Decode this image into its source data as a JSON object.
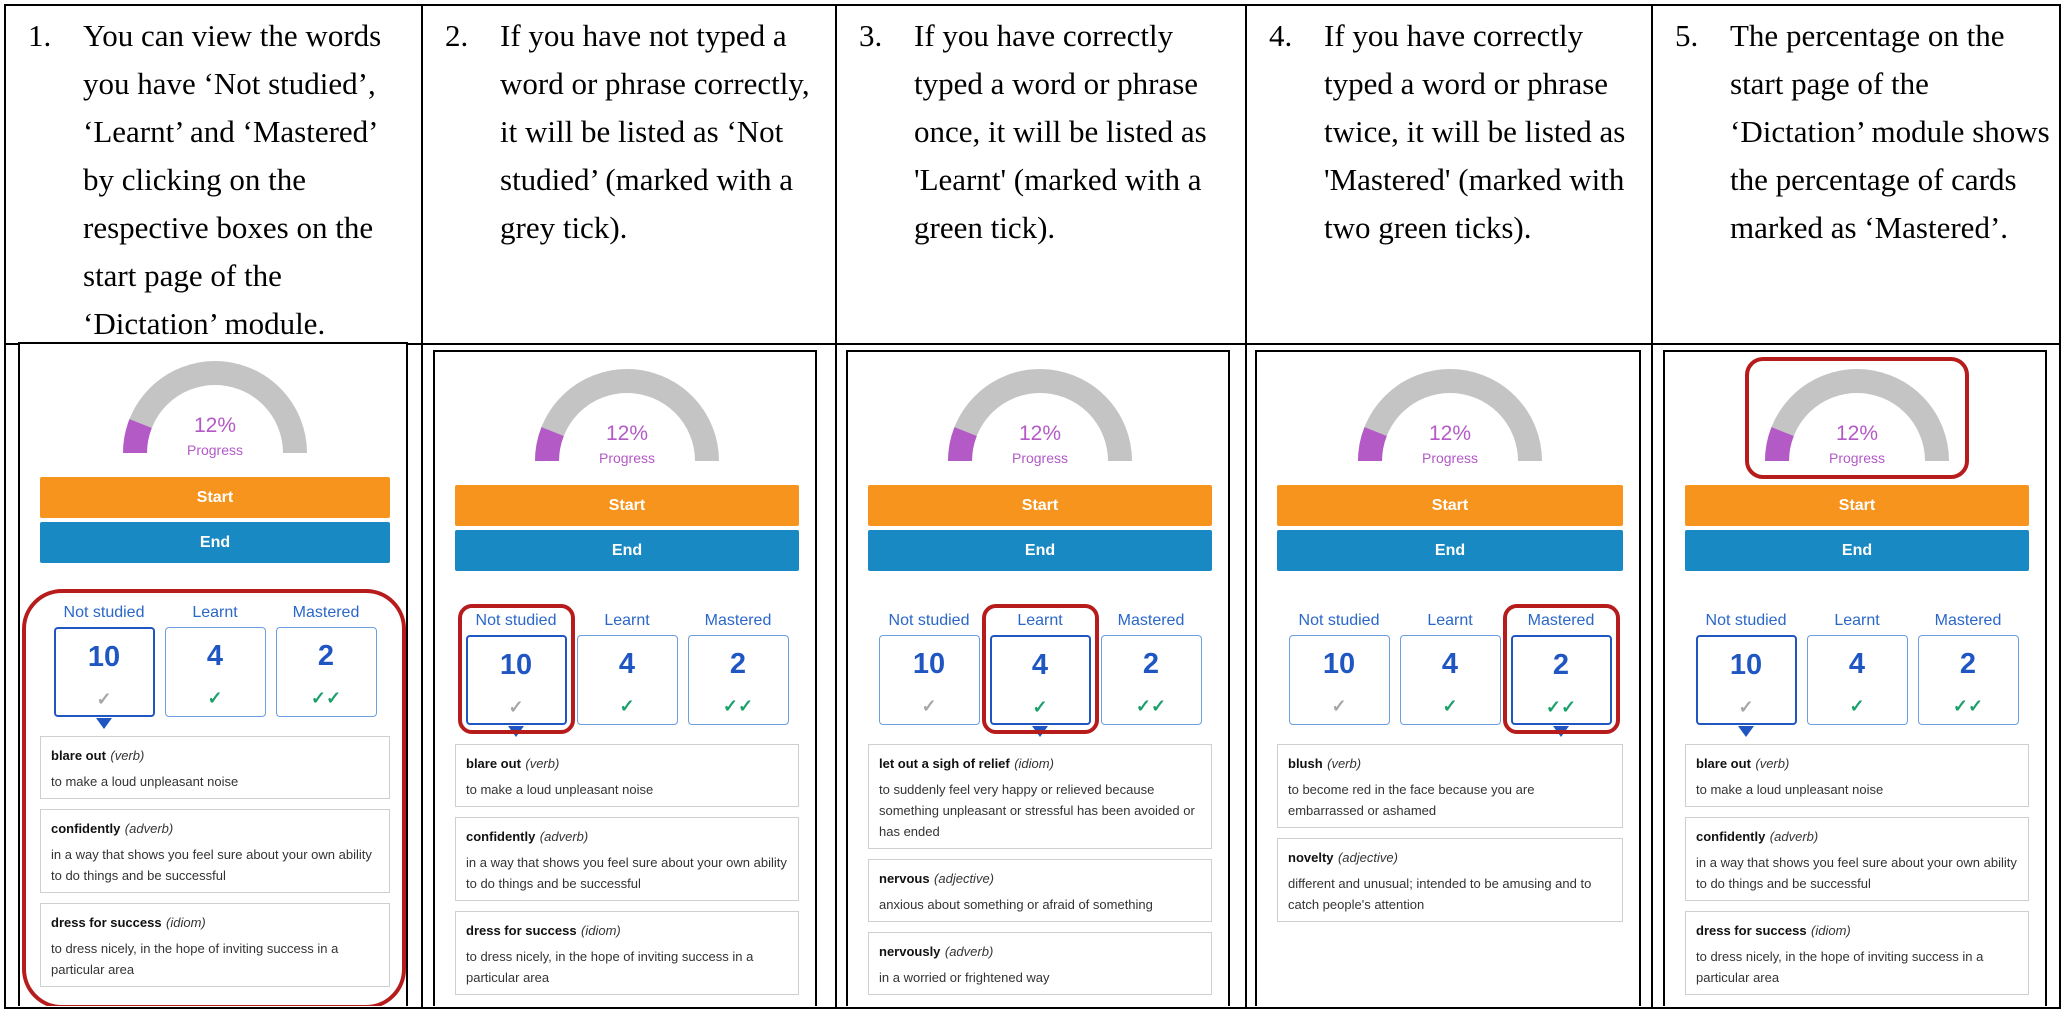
{
  "instructions": [
    {
      "num": "1.",
      "text": "You can view the words you have ‘Not studied’, ‘Learnt’ and ‘Mastered’ by clicking on the respective boxes on the start page of the ‘Dictation’ module."
    },
    {
      "num": "2.",
      "text": "If you have not typed a word or phrase correctly, it will be listed as ‘Not studied’ (marked with a grey tick)."
    },
    {
      "num": "3.",
      "text": "If you have correctly typed a word or phrase once, it will be listed as 'Learnt' (marked with a green tick)."
    },
    {
      "num": "4.",
      "text": "If you have correctly typed a word or phrase twice, it will be listed as 'Mastered' (marked with two green ticks)."
    },
    {
      "num": "5.",
      "text": "The percentage on the start page of the ‘Dictation’ module shows the percentage of cards marked as ‘Mastered’."
    }
  ],
  "app": {
    "progress_percent": "12%",
    "progress_value": 0.12,
    "progress_label": "Progress",
    "start_label": "Start",
    "end_label": "End",
    "tabs": [
      {
        "label": "Not studied",
        "count": "10",
        "tick": "✓",
        "tick_style": "grey"
      },
      {
        "label": "Learnt",
        "count": "4",
        "tick": "✓",
        "tick_style": "green"
      },
      {
        "label": "Mastered",
        "count": "2",
        "tick": "✓✓",
        "tick_style": "green"
      }
    ],
    "colors": {
      "gauge_fill": "#b35ac7",
      "gauge_track": "#c4c4c4",
      "start": "#f7941d",
      "end": "#1889c2",
      "highlight": "#b71c1c"
    }
  },
  "card_sets": {
    "not_studied": [
      {
        "word": "blare out",
        "type": "(verb)",
        "def": "to make a loud unpleasant noise"
      },
      {
        "word": "confidently",
        "type": "(adverb)",
        "def": "in a way that shows you feel sure about your own ability to do things and be successful"
      },
      {
        "word": "dress for success",
        "type": "(idiom)",
        "def": "to dress nicely, in the hope of inviting success in a particular area"
      }
    ],
    "learnt": [
      {
        "word": "let out a sigh of relief",
        "type": "(idiom)",
        "def": "to suddenly feel very happy or relieved because something unpleasant or stressful has been avoided or has ended"
      },
      {
        "word": "nervous",
        "type": "(adjective)",
        "def": "anxious about something or afraid of something"
      },
      {
        "word": "nervously",
        "type": "(adverb)",
        "def": "in a worried or frightened way"
      }
    ],
    "mastered": [
      {
        "word": "blush",
        "type": "(verb)",
        "def": "to become red in the face because you are embarrassed or ashamed"
      },
      {
        "word": "novelty",
        "type": "(adjective)",
        "def": "different and unusual; intended to be amusing and to catch people's attention"
      }
    ]
  },
  "panels": [
    {
      "selected_tab": 0,
      "cards": "not_studied",
      "highlight": "list"
    },
    {
      "selected_tab": 0,
      "cards": "not_studied",
      "highlight": "tab0"
    },
    {
      "selected_tab": 1,
      "cards": "learnt",
      "highlight": "tab1"
    },
    {
      "selected_tab": 2,
      "cards": "mastered",
      "highlight": "tab2"
    },
    {
      "selected_tab": 0,
      "cards": "not_studied",
      "highlight": "gauge"
    }
  ]
}
